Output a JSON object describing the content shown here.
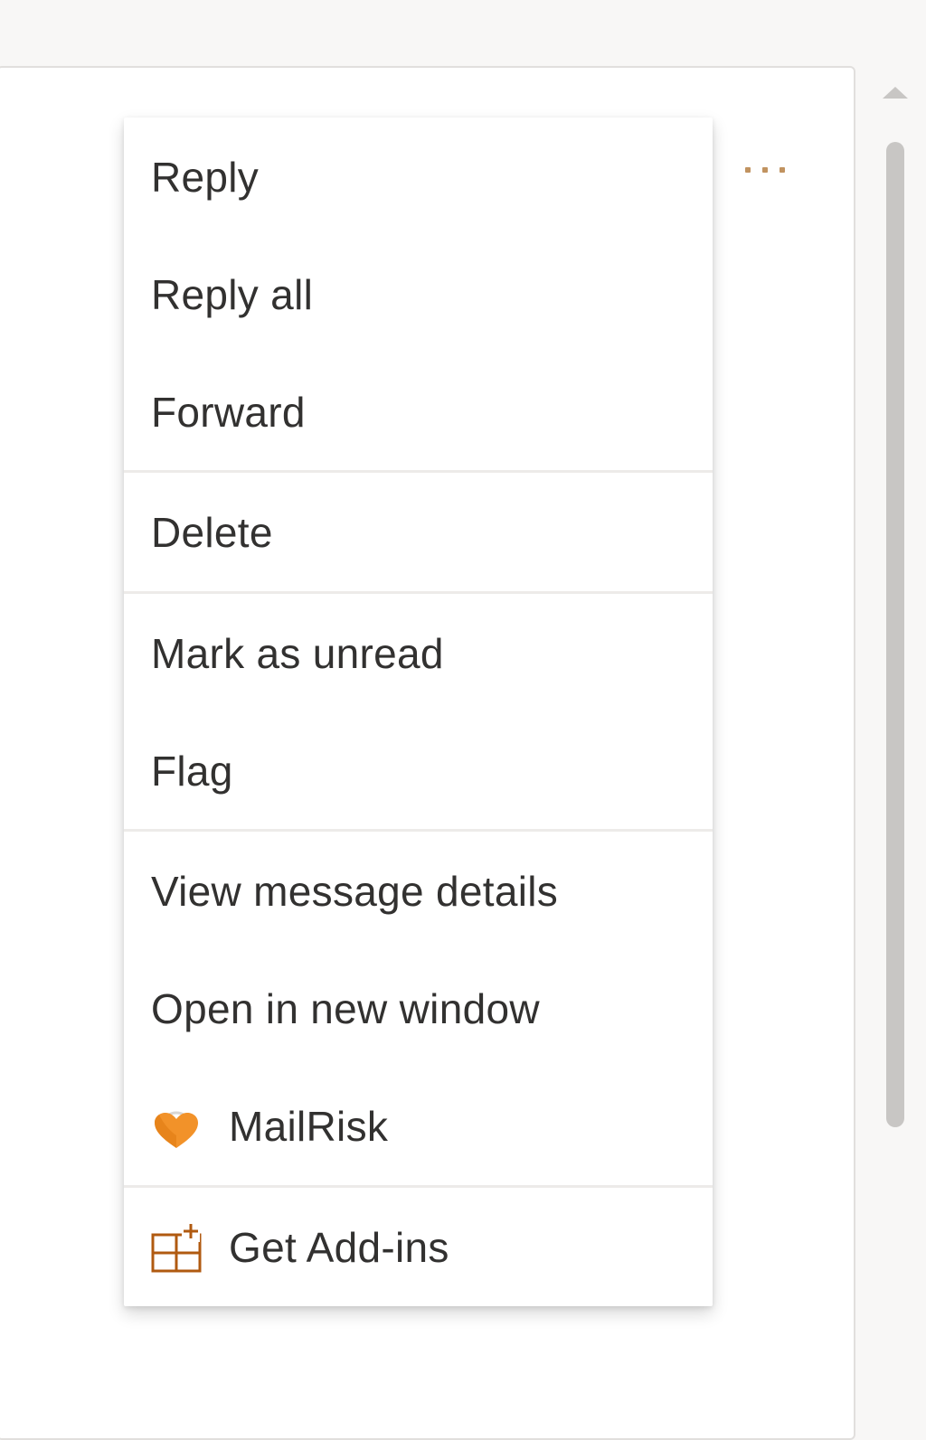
{
  "reading_pane": {
    "more_actions_label": "···"
  },
  "context_menu": {
    "items": [
      {
        "label": "Reply"
      },
      {
        "label": "Reply all"
      },
      {
        "label": "Forward"
      },
      {
        "label": "Delete"
      },
      {
        "label": "Mark as unread"
      },
      {
        "label": "Flag"
      },
      {
        "label": "View message details"
      },
      {
        "label": "Open in new window"
      },
      {
        "label": "MailRisk",
        "icon": "mailrisk-icon"
      },
      {
        "label": "Get Add-ins",
        "icon": "add-ins-icon"
      }
    ]
  },
  "colors": {
    "menu_text": "#323130",
    "accent_brown": "#b05a10",
    "mailrisk_orange": "#f29229",
    "more_dots": "#c19360",
    "divider": "#edebe9",
    "scrollbar": "#c8c6c4"
  }
}
